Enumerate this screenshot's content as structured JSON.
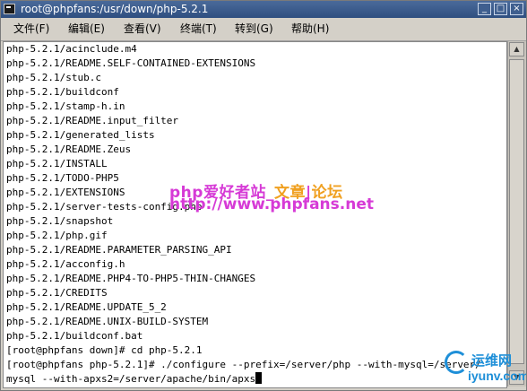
{
  "window": {
    "title": "root@phpfans:/usr/down/php-5.2.1",
    "minimize_glyph": "_",
    "maximize_glyph": "□",
    "close_glyph": "×"
  },
  "menubar": {
    "items": [
      {
        "label": "文件(F)"
      },
      {
        "label": "编辑(E)"
      },
      {
        "label": "查看(V)"
      },
      {
        "label": "终端(T)"
      },
      {
        "label": "转到(G)"
      },
      {
        "label": "帮助(H)"
      }
    ]
  },
  "terminal": {
    "lines": [
      "php-5.2.1/acinclude.m4",
      "php-5.2.1/README.SELF-CONTAINED-EXTENSIONS",
      "php-5.2.1/stub.c",
      "php-5.2.1/buildconf",
      "php-5.2.1/stamp-h.in",
      "php-5.2.1/README.input_filter",
      "php-5.2.1/generated_lists",
      "php-5.2.1/README.Zeus",
      "php-5.2.1/INSTALL",
      "php-5.2.1/TODO-PHP5",
      "php-5.2.1/EXTENSIONS",
      "php-5.2.1/server-tests-config.php",
      "php-5.2.1/snapshot",
      "php-5.2.1/php.gif",
      "php-5.2.1/README.PARAMETER_PARSING_API",
      "php-5.2.1/acconfig.h",
      "php-5.2.1/README.PHP4-TO-PHP5-THIN-CHANGES",
      "php-5.2.1/CREDITS",
      "php-5.2.1/README.UPDATE_5_2",
      "php-5.2.1/README.UNIX-BUILD-SYSTEM",
      "php-5.2.1/buildconf.bat",
      "[root@phpfans down]# cd php-5.2.1",
      "[root@phpfans php-5.2.1]# ./configure --prefix=/server/php --with-mysql=/server/",
      "mysql --with-apxs2=/server/apache/bin/apxs"
    ]
  },
  "watermark": {
    "part1": "php爱好者站_",
    "part2": "文章",
    "part3": "|",
    "part4": "论坛",
    "url": "http://www.phpfans.net"
  },
  "corner_logo": {
    "top": "运维网",
    "bottom": "iyunv.com"
  }
}
